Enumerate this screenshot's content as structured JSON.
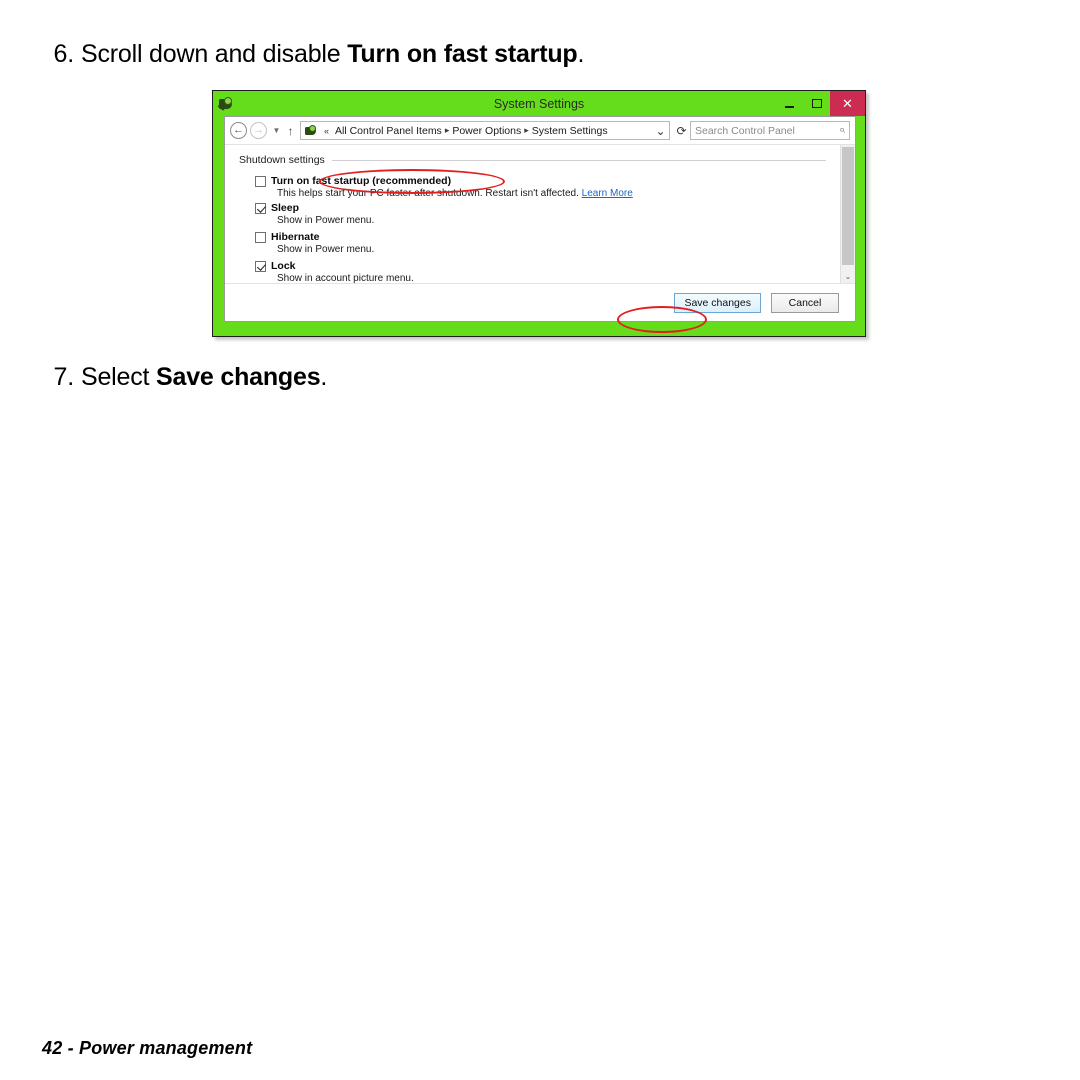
{
  "page": {
    "footer": "42 - Power management",
    "steps": [
      {
        "number": "6.",
        "prefix": "Scroll down and disable ",
        "bold": "Turn on fast startup",
        "suffix": "."
      },
      {
        "number": "7.",
        "prefix": "Select ",
        "bold": "Save changes",
        "suffix": "."
      }
    ]
  },
  "window": {
    "title": "System Settings",
    "title_icon": "control-panel-icon",
    "controls": {
      "minimize": "–",
      "maximize": "□",
      "close": "✕"
    },
    "addressbar": {
      "back": "←",
      "forward": "→",
      "history_dropdown": "▼",
      "up": "↑",
      "path_icon": "control-panel-icon",
      "overflow": "«",
      "breadcrumbs": [
        "All Control Panel Items",
        "Power Options",
        "System Settings"
      ],
      "separator": "▸",
      "path_dropdown": "⌄",
      "refresh": "⟳",
      "search_placeholder": "Search Control Panel",
      "search_value": "",
      "search_icon": "search-icon"
    },
    "content": {
      "group_title": "Shutdown settings",
      "options": [
        {
          "label": "Turn on fast startup (recommended)",
          "checked": false,
          "description": "This helps start your PC faster after shutdown. Restart isn't affected.",
          "link": "Learn More",
          "highlighted": true
        },
        {
          "label": "Sleep",
          "checked": true,
          "description": "Show in Power menu.",
          "link": "",
          "highlighted": false
        },
        {
          "label": "Hibernate",
          "checked": false,
          "description": "Show in Power menu.",
          "link": "",
          "highlighted": false
        },
        {
          "label": "Lock",
          "checked": true,
          "description": "Show in account picture menu.",
          "link": "",
          "highlighted": false
        }
      ],
      "scrollbar": {
        "down_arrow": "⌄"
      }
    },
    "buttons": {
      "save": "Save changes",
      "cancel": "Cancel"
    },
    "colors": {
      "frame_green": "#66DD1A",
      "close_red": "#CE2B52",
      "annotation_red": "#E02020",
      "link_blue": "#1A66C9"
    }
  }
}
